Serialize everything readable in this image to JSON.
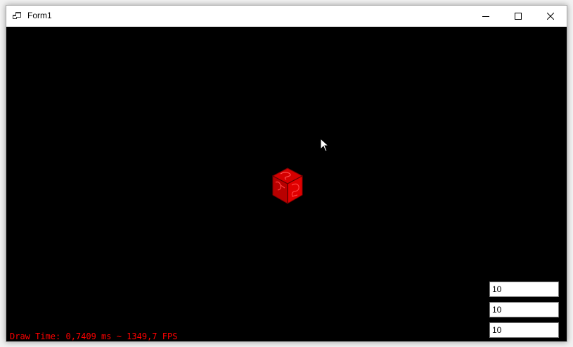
{
  "window": {
    "title": "Form1",
    "icon": "winforms-app-icon"
  },
  "caption_buttons": {
    "minimize": "minimize-icon",
    "maximize": "maximize-icon",
    "close": "close-icon"
  },
  "viewport": {
    "background": "#000000",
    "object": "red-cube",
    "object_color": "#ff0000"
  },
  "inputs": [
    {
      "value": "10"
    },
    {
      "value": "10"
    },
    {
      "value": "10"
    }
  ],
  "status": {
    "text": "Draw Time: 0,7409 ms ~ 1349,7 FPS",
    "color": "#ff0000"
  }
}
